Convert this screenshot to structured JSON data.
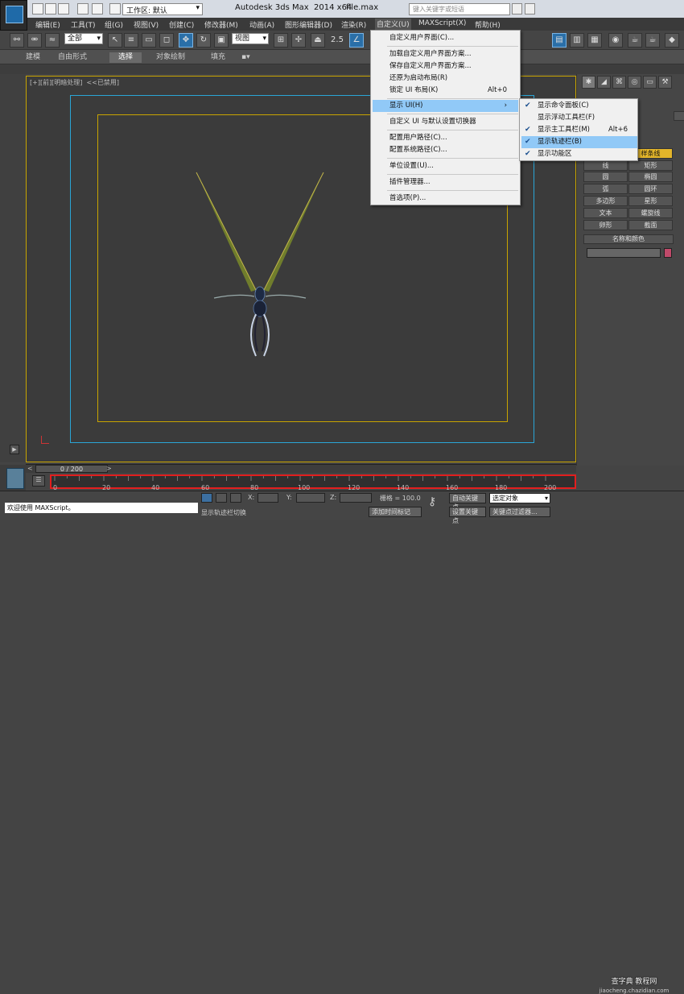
{
  "titlebar": {
    "workspace": "工作区: 默认",
    "app_title": "Autodesk 3ds Max  2014 x64",
    "file_name": "file.max",
    "search_placeholder": "键入关键字或短语"
  },
  "menubar": {
    "items": [
      "编辑(E)",
      "工具(T)",
      "组(G)",
      "视图(V)",
      "创建(C)",
      "修改器(M)",
      "动画(A)",
      "图形编辑器(D)",
      "渲染(R)",
      "自定义(U)",
      "MAXScript(X)",
      "帮助(H)"
    ]
  },
  "toolbar": {
    "selection_filter": "全部",
    "coord_system": "视图",
    "snap_value": "2.5"
  },
  "ribbon": {
    "tabs": [
      "建模",
      "自由形式",
      "选择",
      "对象绘制",
      "填充"
    ],
    "selected_tab": "选择"
  },
  "viewport": {
    "label": "[+][前][明暗处理]  <<已禁用]"
  },
  "customize_menu": {
    "items": [
      {
        "label": "自定义用户界面(C)...",
        "shortcut": ""
      },
      {
        "label": "加载自定义用户界面方案...",
        "shortcut": ""
      },
      {
        "label": "保存自定义用户界面方案...",
        "shortcut": ""
      },
      {
        "label": "还原为启动布局(R)",
        "shortcut": ""
      },
      {
        "label": "锁定 UI 布局(K)",
        "shortcut": "Alt+0"
      },
      {
        "label": "显示 UI(H)",
        "shortcut": "›"
      },
      {
        "label": "自定义 UI 与默认设置切换器",
        "shortcut": ""
      },
      {
        "label": "配置用户路径(C)...",
        "shortcut": ""
      },
      {
        "label": "配置系统路径(C)...",
        "shortcut": ""
      },
      {
        "label": "单位设置(U)...",
        "shortcut": ""
      },
      {
        "label": "插件管理器...",
        "shortcut": ""
      },
      {
        "label": "首选项(P)...",
        "shortcut": ""
      }
    ]
  },
  "show_ui_submenu": {
    "items": [
      {
        "label": "显示命令面板(C)",
        "shortcut": "",
        "checked": true
      },
      {
        "label": "显示浮动工具栏(F)",
        "shortcut": "",
        "checked": false
      },
      {
        "label": "显示主工具栏(M)",
        "shortcut": "Alt+6",
        "checked": true
      },
      {
        "label": "显示轨迹栏(B)",
        "shortcut": "",
        "checked": true
      },
      {
        "label": "显示功能区",
        "shortcut": "",
        "checked": true
      }
    ]
  },
  "command_panel": {
    "shape_buttons": [
      "线",
      "矩形",
      "圆",
      "椭圆",
      "弧",
      "圆环",
      "多边形",
      "星形",
      "文本",
      "螺旋线",
      "卵形",
      "截面"
    ],
    "highlighted_top": "样条线",
    "rollout_title": "名称和颜色",
    "color": "#c04a6a"
  },
  "time_slider": {
    "position": "0 / 200",
    "ticks": [
      "0",
      "20",
      "40",
      "60",
      "80",
      "100",
      "120",
      "140",
      "160",
      "180",
      "200"
    ]
  },
  "status": {
    "welcome": "欢迎使用 MAXScript。",
    "prompt": "显示轨迹栏切换",
    "x_label": "X:",
    "y_label": "Y:",
    "z_label": "Z:",
    "grid": "栅格 = 100.0",
    "auto_key": "自动关键点",
    "set_key": "设置关键点",
    "selected": "选定对象",
    "add_time_tag": "添加时间标记",
    "key_filters": "关键点过滤器..."
  },
  "watermark": {
    "line1": "查字典 教程网",
    "line2": "jiaocheng.chazidian.com"
  },
  "colors": {
    "highlight_frame": "#e21e1e",
    "menu_highlight": "#91c9f7",
    "safe_frame_blue": "#2aa5d6",
    "safe_frame_yellow": "#c8a400"
  }
}
